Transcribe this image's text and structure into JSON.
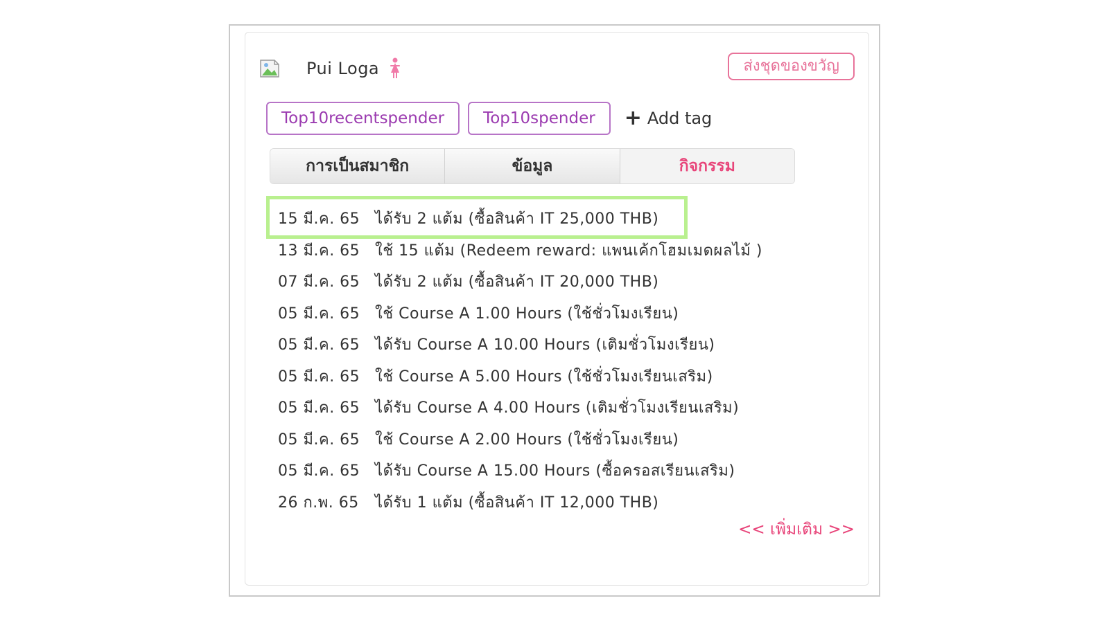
{
  "profile": {
    "avatar_icon": "broken-image-icon",
    "name": "Pui Loga",
    "gender_icon": "female-icon",
    "gender_color": "#f07aa8"
  },
  "gift_button": {
    "label": "ส่งชุดของขวัญ"
  },
  "tags": [
    "Top10recentspender",
    "Top10spender"
  ],
  "add_tag": {
    "icon": "plus-icon",
    "label": "Add tag"
  },
  "tabs": [
    {
      "label": "การเป็นสมาชิก",
      "active": false
    },
    {
      "label": "ข้อมูล",
      "active": false
    },
    {
      "label": "กิจกรรม",
      "active": true
    }
  ],
  "activities": [
    {
      "date": "15 มี.ค. 65",
      "text": "ได้รับ 2 แต้ม (ซื้อสินค้า IT 25,000 THB)"
    },
    {
      "date": "13 มี.ค. 65",
      "text": "ใช้ 15 แต้ม (Redeem reward: แพนเค้กโฮมเมดผลไม้ )"
    },
    {
      "date": "07 มี.ค. 65",
      "text": "ได้รับ 2 แต้ม (ซื้อสินค้า IT 20,000 THB)"
    },
    {
      "date": "05 มี.ค. 65",
      "text": "ใช้ Course A 1.00 Hours (ใช้ชั่วโมงเรียน)"
    },
    {
      "date": "05 มี.ค. 65",
      "text": "ได้รับ Course A 10.00 Hours (เติมชั่วโมงเรียน)"
    },
    {
      "date": "05 มี.ค. 65",
      "text": "ใช้ Course A 5.00 Hours (ใช้ชั่วโมงเรียนเสริม)"
    },
    {
      "date": "05 มี.ค. 65",
      "text": "ได้รับ Course A 4.00 Hours (เติมชั่วโมงเรียนเสริม)"
    },
    {
      "date": "05 มี.ค. 65",
      "text": "ใช้ Course A 2.00 Hours (ใช้ชั่วโมงเรียน)"
    },
    {
      "date": "05 มี.ค. 65",
      "text": "ได้รับ Course A 15.00 Hours (ซื้อครอสเรียนเสริม)"
    },
    {
      "date": "26 ก.พ. 65",
      "text": "ได้รับ 1 แต้ม (ซื้อสินค้า IT 12,000 THB)"
    }
  ],
  "more_link": {
    "label": "<< เพิ่มเติม >>"
  },
  "colors": {
    "accent": "#e8457a",
    "tag_border": "#b774c7",
    "highlight": "#b9f08f"
  }
}
